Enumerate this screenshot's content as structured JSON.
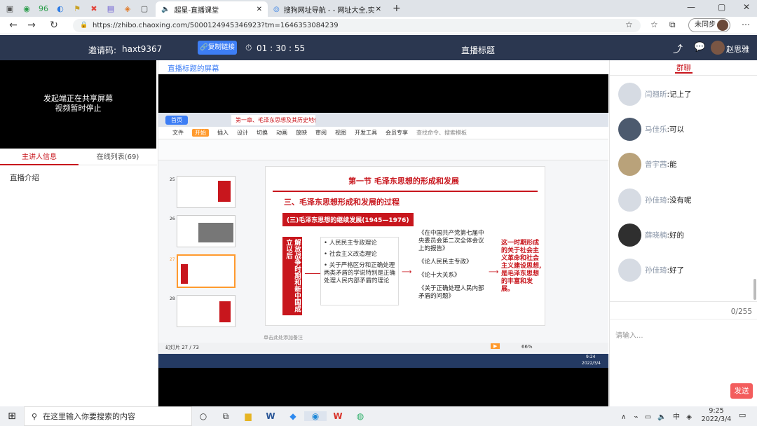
{
  "browser": {
    "tabs": [
      {
        "label": "超星-直播课堂"
      },
      {
        "label": "搜狗网址导航 - - 网址大全,实用"
      }
    ],
    "url": "https://zhibo.chaoxing.com/5000124945346923?tm=1646353084239",
    "sync_label": "未同步"
  },
  "header": {
    "invite_label": "邀请码:",
    "invite_code": "haxt9367",
    "copy_button": "复制链接",
    "timer": "01 : 30 : 55",
    "title": "直播标题",
    "user_name": "赵思雅"
  },
  "left": {
    "screen_line1": "发起端正在共享屏幕",
    "screen_line2": "视频暂时停止",
    "tab_presenter": "主讲人信息",
    "tab_online": "在线列表(69)",
    "intro_label": "直播介绍"
  },
  "center": {
    "screen_title": "直播标题的屏幕"
  },
  "ppt": {
    "file_tab": "第一章、毛泽东思想及其历史地位(...",
    "home_tab": "首页",
    "menu": [
      "文件",
      "开始",
      "插入",
      "设计",
      "切换",
      "动画",
      "放映",
      "审阅",
      "视图",
      "开发工具",
      "会员专享"
    ],
    "search_placeholder": "查找命令、搜索模板",
    "slide_title": "第一节  毛泽东思想的形成和发展",
    "section": "三、毛泽东思想形成和发展的过程",
    "subsection": "(三)毛泽东思想的继续发展(1945—1976)",
    "vertical_label": "解放战争时期和新中国成立以后",
    "bullets": [
      "人民民主专政理论",
      "社会主义改造理论",
      "关于严格区分和正确处理两类矛盾的学说特别是正确处理人民内部矛盾的理论"
    ],
    "works": [
      "《在中国共产党第七届中央委员会第二次全体会议上的报告》",
      "《论人民民主专政》",
      "《论十大关系》",
      "《关于正确处理人民内部矛盾的问题》"
    ],
    "conclusion": "这一时期形成的关于社会主义革命和社会主义建设思想,是毛泽东思想的丰富和发展。",
    "thumb_numbers": [
      "25",
      "26",
      "27",
      "28"
    ],
    "status_left": "幻灯片 27 / 73",
    "zoom": "66%",
    "notes_hint": "单击此处添加备注",
    "inner_time": "9:24",
    "inner_date": "2022/3/4"
  },
  "chat": {
    "tab_label": "群聊",
    "messages": [
      {
        "name": "闫翘昕",
        "text": "记上了"
      },
      {
        "name": "马佳乐",
        "text": "可以"
      },
      {
        "name": "曾宇茜",
        "text": "能"
      },
      {
        "name": "孙佳琦",
        "text": "没有呢"
      },
      {
        "name": "薛晓楠",
        "text": "好的"
      },
      {
        "name": "孙佳琦",
        "text": "好了"
      }
    ],
    "counter": "0/255",
    "input_placeholder": "请输入...",
    "send_button": "发送"
  },
  "taskbar": {
    "search_placeholder": "在这里输入你要搜索的内容",
    "time": "9:25",
    "date": "2022/3/4",
    "ime": "中"
  }
}
